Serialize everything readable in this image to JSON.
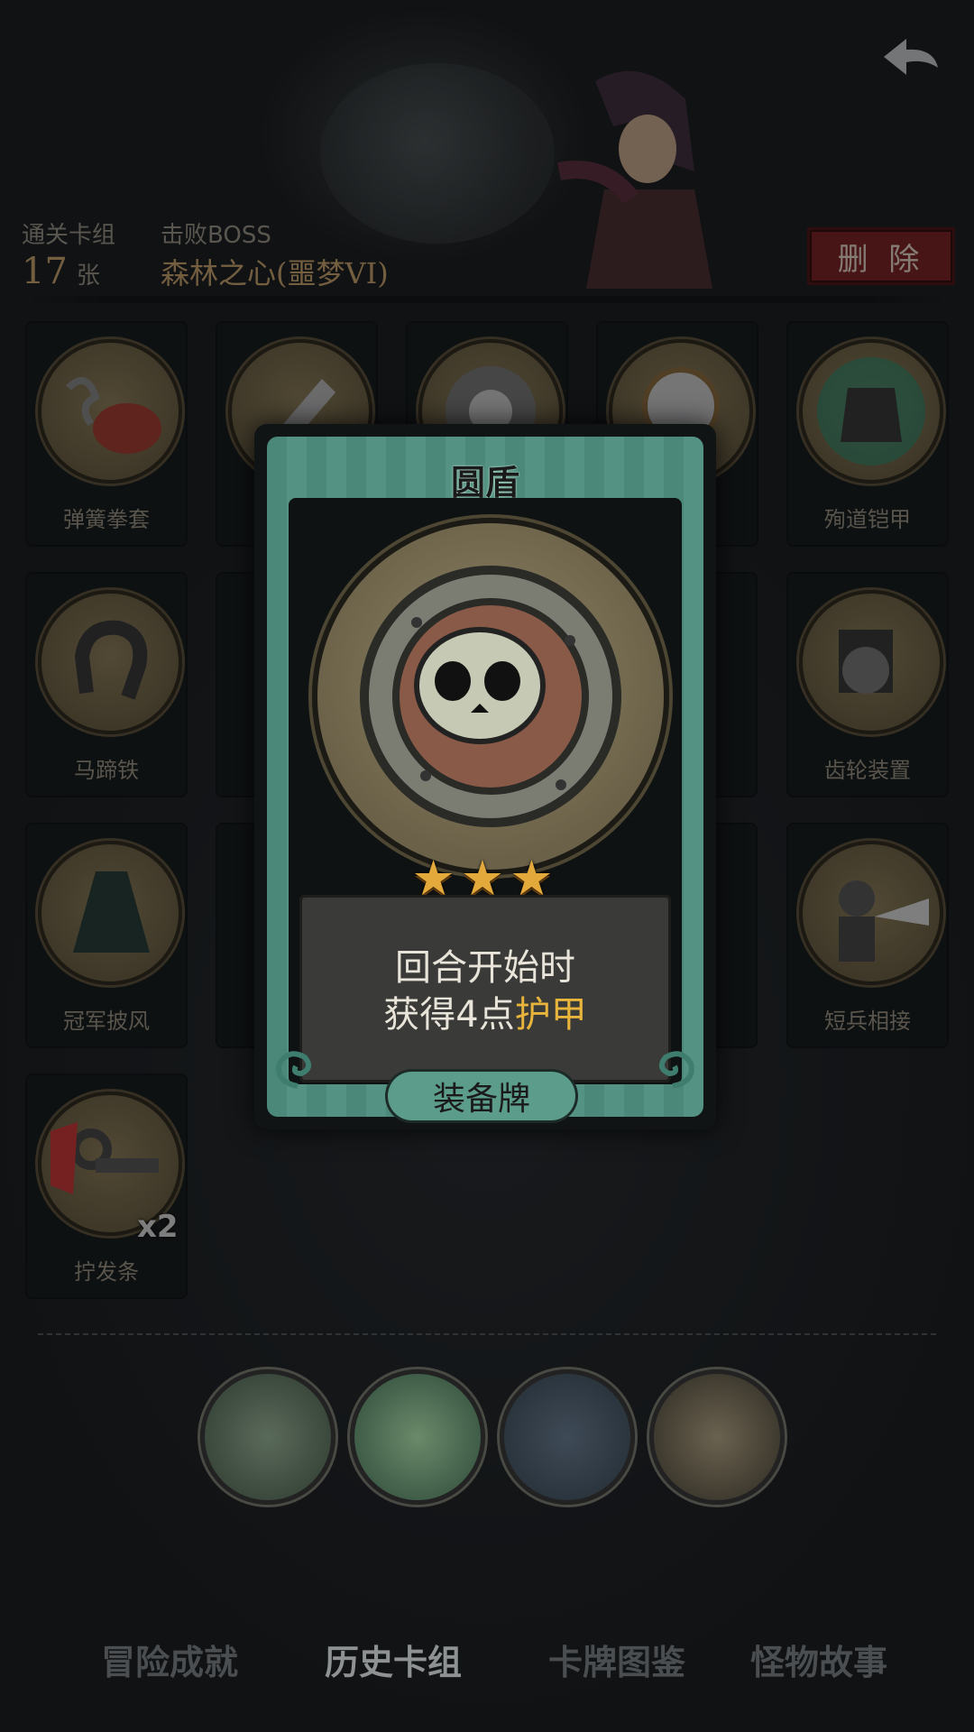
{
  "header": {
    "deck_label": "通关卡组",
    "deck_count": "17",
    "deck_unit": "张",
    "boss_label": "击败BOSS",
    "boss_name": "森林之心(噩梦VI)",
    "delete_label": "删 除"
  },
  "cards": [
    {
      "label": "弹簧拳套",
      "icon": "spring-glove-icon"
    },
    {
      "label": "",
      "icon": "dagger-icon"
    },
    {
      "label": "",
      "icon": "skull-shield-icon"
    },
    {
      "label": "",
      "icon": "mirror-icon"
    },
    {
      "label": "殉道铠甲",
      "icon": "martyr-armor-icon"
    },
    {
      "label": "马蹄铁",
      "icon": "horseshoe-icon"
    },
    {
      "label": "齿轮装置",
      "icon": "gear-device-icon"
    },
    {
      "label": "冠军披风",
      "icon": "cloak-icon"
    },
    {
      "label": "短兵相接",
      "icon": "knight-icon"
    },
    {
      "label": "拧发条",
      "icon": "wind-up-key-icon",
      "count": "x2"
    }
  ],
  "popup": {
    "title": "圆盾",
    "stars": "★★★",
    "rarity": 3,
    "desc_line1": "回合开始时",
    "desc_line2_prefix": "获得4点",
    "desc_line2_keyword": "护甲",
    "type": "装备牌"
  },
  "bosses": [
    {
      "icon": "bandit-boss-icon"
    },
    {
      "icon": "forest-heart-boss-icon"
    },
    {
      "icon": "blade-boss-icon"
    },
    {
      "icon": "arena-boss-icon"
    }
  ],
  "nav": {
    "tab1": "冒险成就",
    "tab2": "历史卡组",
    "tab3": "卡牌图鉴",
    "tab4": "怪物故事"
  },
  "colors": {
    "accent_gold": "#c9a36a",
    "delete_red": "#7a1e1e",
    "card_teal": "#4f8f80",
    "keyword": "#e8b43c"
  }
}
